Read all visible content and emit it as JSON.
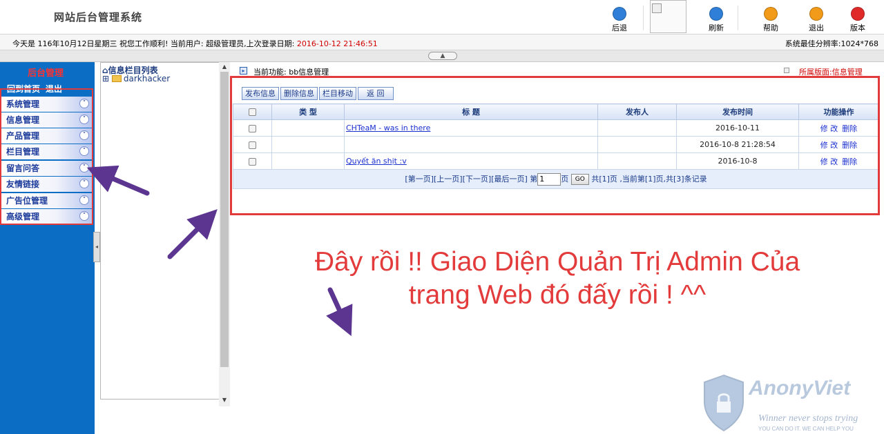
{
  "app_title": "网站后台管理系统",
  "toolbar": {
    "back": "后退",
    "refresh": "刷新",
    "help": "帮助",
    "exit": "退出",
    "version": "版本",
    "colors": {
      "back": "#2f7fd8",
      "refresh": "#2f7fd8",
      "help": "#f29a1a",
      "exit": "#f29a1a",
      "version": "#e02a2a"
    }
  },
  "status": {
    "today_label": "今天是",
    "date": "116年10月12日星期三",
    "greeting": "祝您工作顺利!",
    "user_label": "当前用户:",
    "user": "超级管理员,",
    "last_login_label": "上次登录日期:",
    "last_login": "2016-10-12 21:46:51",
    "resolution": "系统最佳分辨率:1024*768"
  },
  "sidebar": {
    "title": "后台管理",
    "link_home": "回到首页",
    "link_exit": "退出",
    "items": [
      {
        "label": "系统管理"
      },
      {
        "label": "信息管理"
      },
      {
        "label": "产品管理"
      },
      {
        "label": "栏目管理"
      },
      {
        "label": "留言问答"
      },
      {
        "label": "友情链接"
      },
      {
        "label": "广告位管理"
      },
      {
        "label": "高级管理"
      }
    ]
  },
  "tree": {
    "title": "信息栏目列表",
    "node": "darkhacker"
  },
  "content": {
    "current_label": "当前功能:",
    "current_value": "bb信息管理",
    "belong_label": "所属版面:",
    "belong_value": "信息管理",
    "buttons": {
      "publish": "发布信息",
      "delete": "删除信息",
      "move": "栏目移动",
      "back": "返 回"
    },
    "columns": [
      "类 型",
      "标 题",
      "发布人",
      "发布时间",
      "功能操作"
    ],
    "rows": [
      {
        "type": "",
        "title": "CHTeaM - was in there",
        "author": "",
        "time": "2016-10-11",
        "edit": "修 改",
        "remove": "删除"
      },
      {
        "type": "",
        "title": "",
        "author": "",
        "time": "2016-10-8 21:28:54",
        "edit": "修 改",
        "remove": "删除"
      },
      {
        "type": "",
        "title": "Quyết ăn shịt :v",
        "author": "",
        "time": "2016-10-8",
        "edit": "修 改",
        "remove": "删除"
      }
    ],
    "pager": {
      "first": "[第一页]",
      "prev": "[上一页]",
      "next": "[下一页]",
      "last": "[最后一页]",
      "goto_prefix": "第",
      "page_value": "1",
      "goto_suffix": "页",
      "go": "GO",
      "summary": "共[1]页 ,当前第[1]页,共[3]条记录"
    }
  },
  "annotation": {
    "line1": "Đây rồi !! Giao Diện Quản Trị Admin Của",
    "line2": "trang Web đó đấy rồi ! ^^",
    "color": "#e33b3b",
    "arrow_color": "#5b3590"
  },
  "watermark": {
    "brand": "AnonyViet",
    "tagline": "Winner never stops trying",
    "sub": "YOU CAN DO IT. WE CAN HELP YOU"
  }
}
